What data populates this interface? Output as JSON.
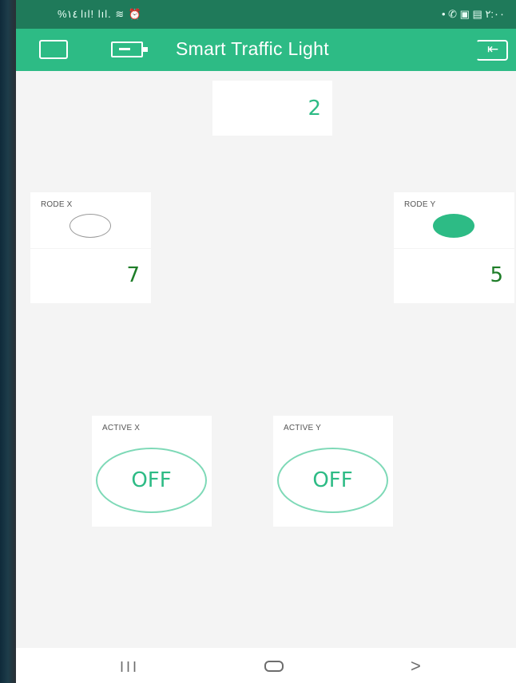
{
  "status_bar": {
    "left": "%١٤ lıl! lıl. ≋ ⏰",
    "right": "• ✆ ▣ ▤ ٢:٠٠"
  },
  "app_bar": {
    "title": "Smart Traffic Light",
    "icons": [
      "square-icon",
      "device-icon",
      "exit-icon"
    ]
  },
  "widgets": {
    "top_display": {
      "value": "2"
    },
    "rode_x": {
      "label": "RODE X",
      "led_state": "off",
      "value": "7"
    },
    "rode_y": {
      "label": "RODE Y",
      "led_state": "on",
      "value": "5"
    },
    "active_x": {
      "label": "ACTIVE X",
      "button": "OFF"
    },
    "active_y": {
      "label": "ACTIVE Y",
      "button": "OFF"
    }
  },
  "colors": {
    "accent": "#2dbb85",
    "status_bar": "#1f7a5a",
    "value_dark": "#1e7d28"
  },
  "nav_bar": {
    "recent": "III",
    "back": ">"
  }
}
